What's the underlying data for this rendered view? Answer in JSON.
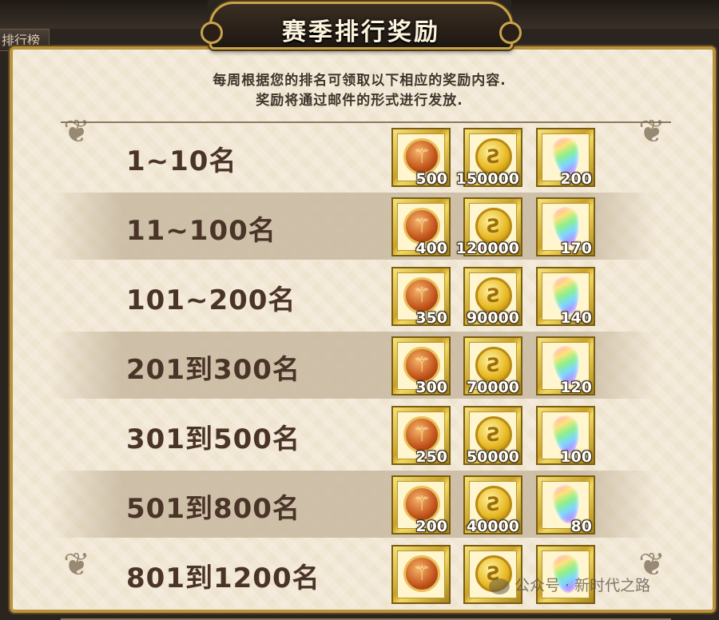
{
  "background_tab": {
    "label": "排行榜"
  },
  "title": "赛季排行奖励",
  "description": [
    "每周根据您的排名可领取以下相应的奖励内容.",
    "奖励将通过邮件的形式进行发放."
  ],
  "rewards": [
    {
      "rank": "1~10名",
      "items": [
        {
          "icon": "medal-icon",
          "qty": "500"
        },
        {
          "icon": "gold-coin-icon",
          "qty": "150000"
        },
        {
          "icon": "rainbow-gem-icon",
          "qty": "200"
        }
      ]
    },
    {
      "rank": "11~100名",
      "items": [
        {
          "icon": "medal-icon",
          "qty": "400"
        },
        {
          "icon": "gold-coin-icon",
          "qty": "120000"
        },
        {
          "icon": "rainbow-gem-icon",
          "qty": "170"
        }
      ]
    },
    {
      "rank": "101~200名",
      "items": [
        {
          "icon": "medal-icon",
          "qty": "350"
        },
        {
          "icon": "gold-coin-icon",
          "qty": "90000"
        },
        {
          "icon": "rainbow-gem-icon",
          "qty": "140"
        }
      ]
    },
    {
      "rank": "201到300名",
      "items": [
        {
          "icon": "medal-icon",
          "qty": "300"
        },
        {
          "icon": "gold-coin-icon",
          "qty": "70000"
        },
        {
          "icon": "rainbow-gem-icon",
          "qty": "120"
        }
      ]
    },
    {
      "rank": "301到500名",
      "items": [
        {
          "icon": "medal-icon",
          "qty": "250"
        },
        {
          "icon": "gold-coin-icon",
          "qty": "50000"
        },
        {
          "icon": "rainbow-gem-icon",
          "qty": "100"
        }
      ]
    },
    {
      "rank": "501到800名",
      "items": [
        {
          "icon": "medal-icon",
          "qty": "200"
        },
        {
          "icon": "gold-coin-icon",
          "qty": "40000"
        },
        {
          "icon": "rainbow-gem-icon",
          "qty": "80"
        }
      ]
    },
    {
      "rank": "801到1200名",
      "items": [
        {
          "icon": "medal-icon",
          "qty": ""
        },
        {
          "icon": "gold-coin-icon",
          "qty": ""
        },
        {
          "icon": "rainbow-gem-icon",
          "qty": ""
        }
      ]
    }
  ],
  "watermark": "公众号 · 新时代之路",
  "colors": {
    "frame_gold": "#c9a44c",
    "panel_bg": "#efe4cf",
    "rank_text": "#4a3427"
  }
}
